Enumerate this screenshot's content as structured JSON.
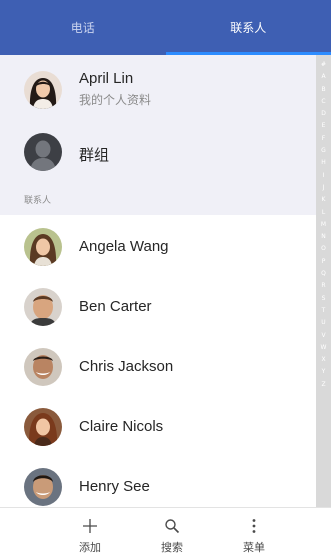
{
  "tabs": [
    {
      "label": "电话",
      "active": false
    },
    {
      "label": "联系人",
      "active": true
    }
  ],
  "profile": {
    "name": "April Lin",
    "subtitle": "我的个人资料"
  },
  "group": {
    "label": "群组"
  },
  "section_label": "联系人",
  "contacts": [
    {
      "name": "Angela Wang"
    },
    {
      "name": "Ben Carter"
    },
    {
      "name": "Chris Jackson"
    },
    {
      "name": "Claire Nicols"
    },
    {
      "name": "Henry See"
    }
  ],
  "index_letters": [
    "#",
    "A",
    "B",
    "C",
    "D",
    "E",
    "F",
    "G",
    "H",
    "I",
    "J",
    "K",
    "L",
    "M",
    "N",
    "O",
    "P",
    "Q",
    "R",
    "S",
    "T",
    "U",
    "V",
    "W",
    "X",
    "Y",
    "Z"
  ],
  "actions": [
    {
      "label": "添加",
      "icon": "plus-icon"
    },
    {
      "label": "搜索",
      "icon": "search-icon"
    },
    {
      "label": "菜单",
      "icon": "more-vert-icon"
    }
  ],
  "colors": {
    "tab_bar": "#3e5fb3",
    "tab_indicator": "#2d8cff",
    "profile_band": "#f0f0f7",
    "index_bar": "#d9d9d9"
  }
}
